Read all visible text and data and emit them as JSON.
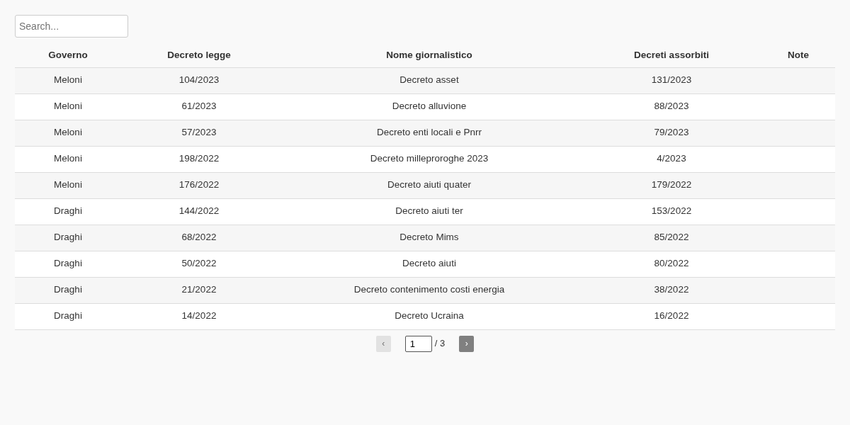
{
  "search": {
    "placeholder": "Search..."
  },
  "table": {
    "columns": [
      "Governo",
      "Decreto legge",
      "Nome giornalistico",
      "Decreti assorbiti",
      "Note"
    ],
    "rows": [
      [
        "Meloni",
        "104/2023",
        "Decreto asset",
        "131/2023",
        ""
      ],
      [
        "Meloni",
        "61/2023",
        "Decreto alluvione",
        "88/2023",
        ""
      ],
      [
        "Meloni",
        "57/2023",
        "Decreto enti locali e Pnrr",
        "79/2023",
        ""
      ],
      [
        "Meloni",
        "198/2022",
        "Decreto milleproroghe 2023",
        "4/2023",
        ""
      ],
      [
        "Meloni",
        "176/2022",
        "Decreto aiuti quater",
        "179/2022",
        ""
      ],
      [
        "Draghi",
        "144/2022",
        "Decreto aiuti ter",
        "153/2022",
        ""
      ],
      [
        "Draghi",
        "68/2022",
        "Decreto Mims",
        "85/2022",
        ""
      ],
      [
        "Draghi",
        "50/2022",
        "Decreto aiuti",
        "80/2022",
        ""
      ],
      [
        "Draghi",
        "21/2022",
        "Decreto contenimento costi energia",
        "38/2022",
        ""
      ],
      [
        "Draghi",
        "14/2022",
        "Decreto Ucraina",
        "16/2022",
        ""
      ]
    ]
  },
  "pagination": {
    "prev": {
      "label": "‹",
      "disabled": true
    },
    "page": "1",
    "total": "/ 3",
    "next": {
      "label": "›",
      "disabled": false
    }
  }
}
